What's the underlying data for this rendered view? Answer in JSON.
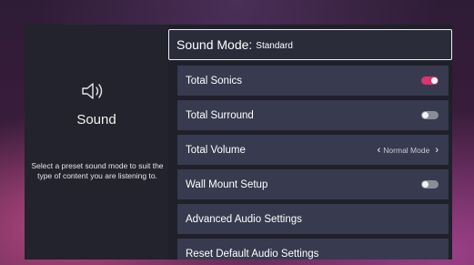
{
  "colors": {
    "panel_bg": "#1f2029",
    "row_bg": "#383a4f",
    "toggle_on": "#d8356e",
    "toggle_off": "#8a8c9a"
  },
  "sidebar": {
    "icon": "speaker-icon",
    "title": "Sound",
    "description": "Select a preset sound mode to suit the type of content you are listening to."
  },
  "menu": {
    "header": {
      "label": "Sound Mode:",
      "value": "Standard"
    },
    "items": [
      {
        "label": "Total Sonics",
        "control": "toggle",
        "state": "on"
      },
      {
        "label": "Total Surround",
        "control": "toggle",
        "state": "off"
      },
      {
        "label": "Total Volume",
        "control": "picker",
        "value": "Normal Mode"
      },
      {
        "label": "Wall Mount Setup",
        "control": "toggle",
        "state": "off"
      },
      {
        "label": "Advanced Audio Settings",
        "control": "none"
      },
      {
        "label": "Reset Default Audio Settings",
        "control": "none"
      }
    ]
  }
}
